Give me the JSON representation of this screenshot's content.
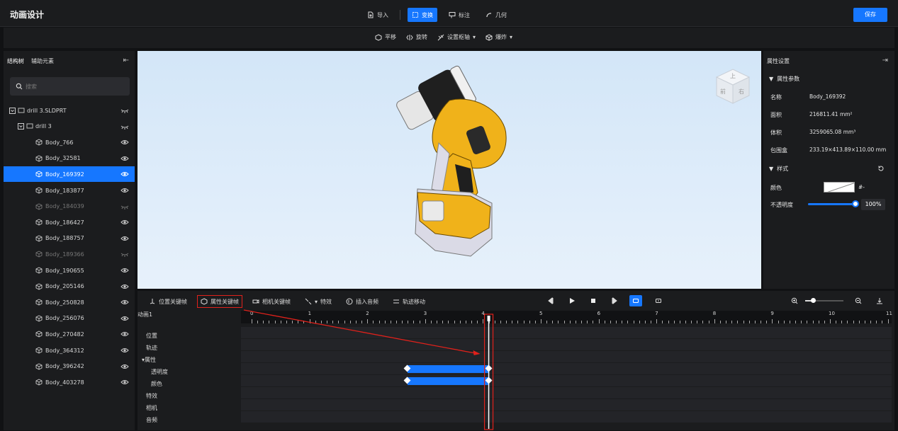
{
  "app": {
    "title": "动画设计",
    "save_label": "保存"
  },
  "top_toolbar": [
    {
      "label": "导入",
      "icon": "import-icon",
      "active": false
    },
    {
      "label": "变换",
      "icon": "transform-icon",
      "active": true
    },
    {
      "label": "标注",
      "icon": "annotation-icon",
      "active": false
    },
    {
      "label": "几何",
      "icon": "geometry-icon",
      "active": false
    }
  ],
  "sub_toolbar": [
    {
      "label": "平移",
      "icon": "move-icon"
    },
    {
      "label": "旋转",
      "icon": "rotate-icon"
    },
    {
      "label": "设置枢轴",
      "icon": "pivot-icon",
      "dropdown": true
    },
    {
      "label": "爆炸",
      "icon": "explode-icon",
      "dropdown": true
    }
  ],
  "left_panel": {
    "tabs": [
      "结构树",
      "辅助元素"
    ],
    "search_placeholder": "搜索",
    "tree": [
      {
        "label": "drill 3.SLDPRT",
        "level": 0,
        "visible": false,
        "selected": false,
        "dim": false
      },
      {
        "label": "drill 3",
        "level": 1,
        "visible": false,
        "selected": false,
        "dim": false
      },
      {
        "label": "Body_766",
        "level": 2,
        "visible": true,
        "selected": false,
        "dim": false
      },
      {
        "label": "Body_32581",
        "level": 2,
        "visible": true,
        "selected": false,
        "dim": false
      },
      {
        "label": "Body_169392",
        "level": 2,
        "visible": true,
        "selected": true,
        "dim": false
      },
      {
        "label": "Body_183877",
        "level": 2,
        "visible": true,
        "selected": false,
        "dim": false
      },
      {
        "label": "Body_184039",
        "level": 2,
        "visible": false,
        "selected": false,
        "dim": true
      },
      {
        "label": "Body_186427",
        "level": 2,
        "visible": true,
        "selected": false,
        "dim": false
      },
      {
        "label": "Body_188757",
        "level": 2,
        "visible": true,
        "selected": false,
        "dim": false
      },
      {
        "label": "Body_189366",
        "level": 2,
        "visible": false,
        "selected": false,
        "dim": true
      },
      {
        "label": "Body_190655",
        "level": 2,
        "visible": true,
        "selected": false,
        "dim": false
      },
      {
        "label": "Body_205146",
        "level": 2,
        "visible": true,
        "selected": false,
        "dim": false
      },
      {
        "label": "Body_250828",
        "level": 2,
        "visible": true,
        "selected": false,
        "dim": false
      },
      {
        "label": "Body_256076",
        "level": 2,
        "visible": true,
        "selected": false,
        "dim": false
      },
      {
        "label": "Body_270482",
        "level": 2,
        "visible": true,
        "selected": false,
        "dim": false
      },
      {
        "label": "Body_364312",
        "level": 2,
        "visible": true,
        "selected": false,
        "dim": false
      },
      {
        "label": "Body_396242",
        "level": 2,
        "visible": true,
        "selected": false,
        "dim": false
      },
      {
        "label": "Body_403278",
        "level": 2,
        "visible": true,
        "selected": false,
        "dim": false
      }
    ]
  },
  "right_panel": {
    "title": "属性设置",
    "section_params": "属性参数",
    "props": [
      {
        "label": "名称",
        "value": "Body_169392"
      },
      {
        "label": "面积",
        "value": "216811.41 mm²"
      },
      {
        "label": "体积",
        "value": "3259065.08 mm³"
      },
      {
        "label": "包围盒",
        "value": "233.19×413.89×110.00 mm"
      }
    ],
    "section_style": "样式",
    "color_label": "颜色",
    "color_value": "#-",
    "opacity_label": "不透明度",
    "opacity_value": "100%",
    "opacity_fraction": 1.0
  },
  "timeline": {
    "buttons": [
      {
        "label": "位置关键帧",
        "icon": "position-keyframe-icon"
      },
      {
        "label": "属性关键帧",
        "icon": "property-keyframe-icon",
        "highlighted": true
      },
      {
        "label": "相机关键帧",
        "icon": "camera-keyframe-icon"
      },
      {
        "label": "特效",
        "icon": "effects-icon",
        "dropdown": true
      },
      {
        "label": "插入音频",
        "icon": "audio-icon"
      },
      {
        "label": "轨迹移动",
        "icon": "track-move-icon"
      }
    ],
    "animation_name": "动画1",
    "tracks": [
      {
        "label": "位置",
        "indent": 1
      },
      {
        "label": "轨迹",
        "indent": 1
      },
      {
        "label": "▾属性",
        "indent": 0
      },
      {
        "label": "透明度",
        "indent": 2
      },
      {
        "label": "颜色",
        "indent": 2
      },
      {
        "label": "特效",
        "indent": 1
      },
      {
        "label": "相机",
        "indent": 1
      },
      {
        "label": "音频",
        "indent": 1
      }
    ],
    "ruler_labels": [
      "0",
      "1",
      "2",
      "3",
      "4",
      "5",
      "6",
      "7",
      "8",
      "9",
      "10",
      "11"
    ],
    "playhead_time": 4.1,
    "keyframe_bars": [
      {
        "track": "透明度",
        "start": 2.7,
        "end": 4.1
      },
      {
        "track": "颜色",
        "start": 2.7,
        "end": 4.1
      }
    ],
    "view_cube_faces": [
      "上",
      "前",
      "右"
    ]
  },
  "colors": {
    "accent": "#1677ff",
    "highlight": "#e0211b",
    "panel": "#1b1c1e"
  }
}
